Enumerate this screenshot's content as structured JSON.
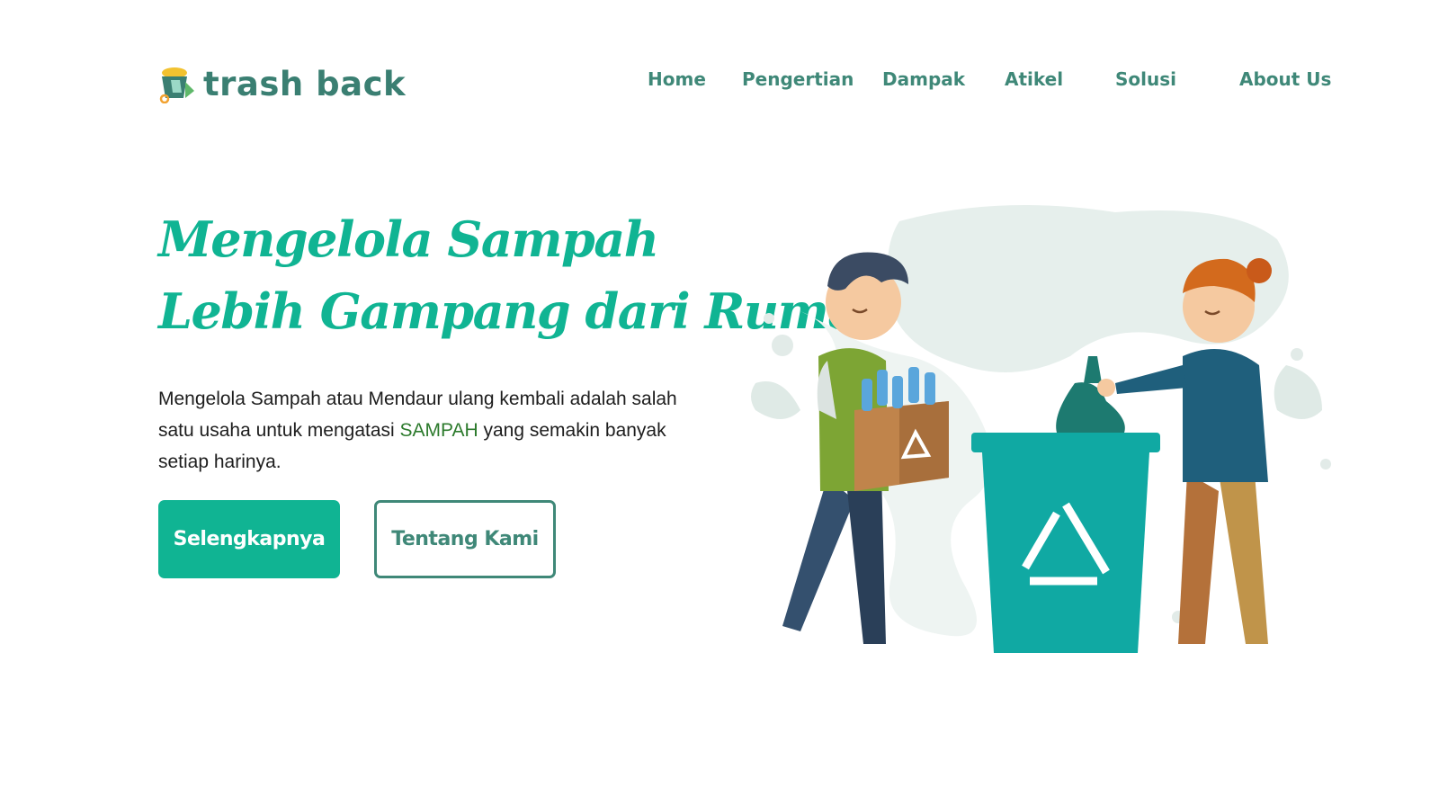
{
  "brand": {
    "name": "trash back"
  },
  "nav": [
    {
      "id": "home",
      "label": "Home"
    },
    {
      "id": "pengertian",
      "label": "Pengertian"
    },
    {
      "id": "dampak",
      "label": "Dampak"
    },
    {
      "id": "atikel",
      "label": "Atikel"
    },
    {
      "id": "solusi",
      "label": "Solusi"
    },
    {
      "id": "about",
      "label": "About Us"
    }
  ],
  "hero": {
    "title_line1": "Mengelola Sampah",
    "title_line2": "Lebih Gampang dari Rumah",
    "desc_before": "Mengelola Sampah atau Mendaur ulang kembali adalah salah satu usaha untuk mengatasi ",
    "desc_highlight": "SAMPAH",
    "desc_after": " yang semakin banyak setiap harinya.",
    "primary_button": "Selengkapnya",
    "secondary_button": "Tentang Kami"
  },
  "colors": {
    "brand_green": "#10b493",
    "nav_text": "#3f8878",
    "teal_bin": "#10a9a3",
    "highlight_text": "#2c7a2c"
  },
  "icons": [
    "trash-bin-logo-icon",
    "recycle-icon"
  ]
}
